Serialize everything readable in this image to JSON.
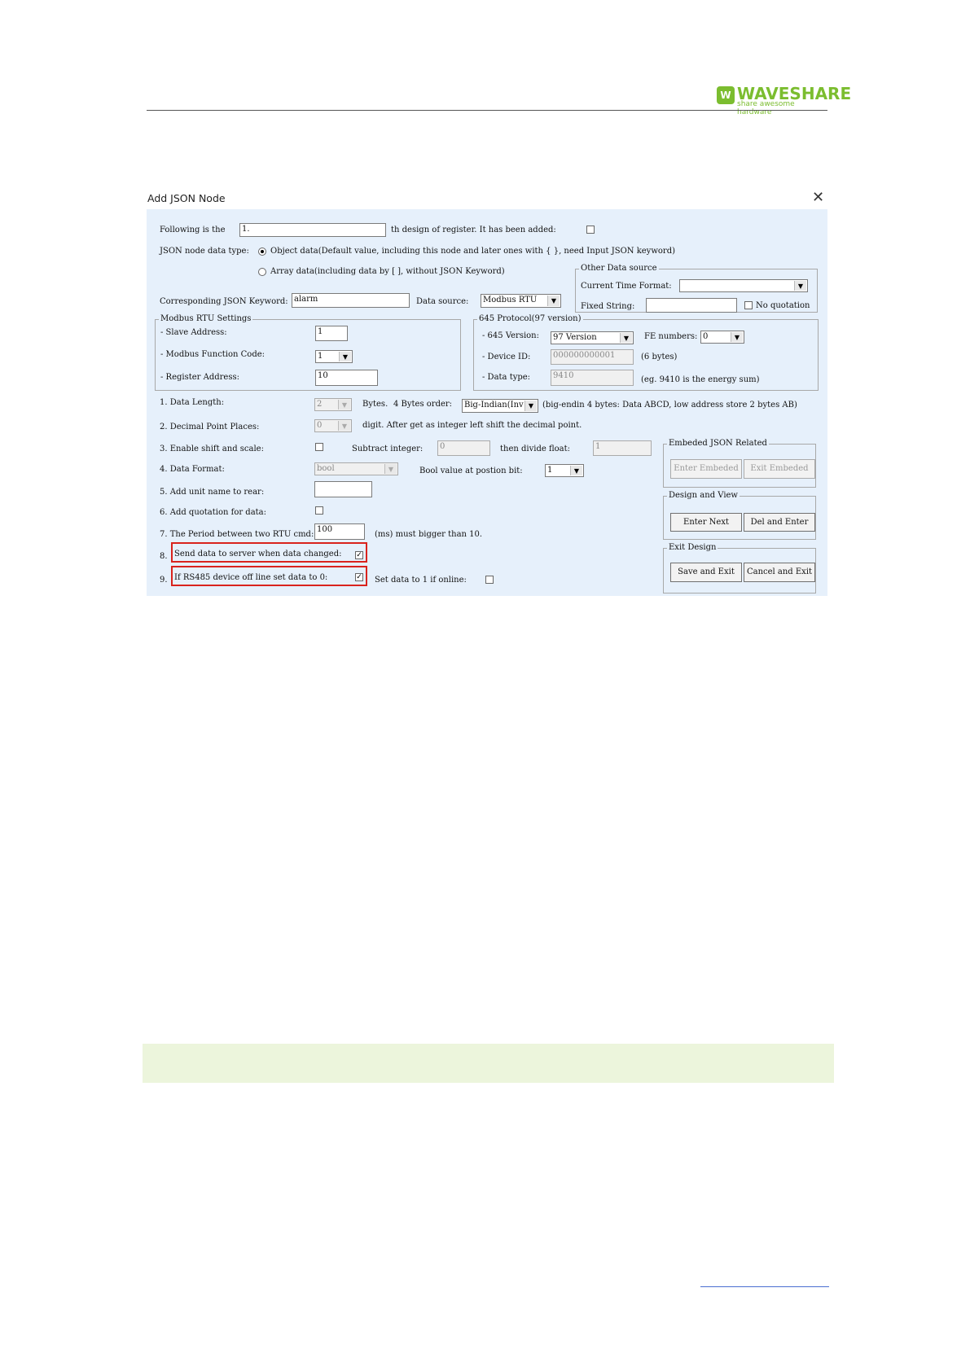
{
  "page_header": {
    "logo_badge": "W",
    "logo_name": "WAVESHARE",
    "logo_tagline": "share awesome hardware",
    "brand_color": "#7bbd2f"
  },
  "dialog": {
    "title": "Add JSON Node",
    "close_icon": "close-icon",
    "following_label": "Following is the",
    "register_index": "1.",
    "register_suffix": "th design of register. It has been added:",
    "node_type_label": "JSON node data type:",
    "object_option": "Object data(Default value, including this node and later ones with { }, need Input JSON keyword)",
    "array_option": "Array data(including data by [ ], without JSON Keyword)",
    "keyword_label": "Corresponding JSON Keyword:",
    "keyword_value": "alarm",
    "data_source_label": "Data source:",
    "data_source_value": "Modbus RTU",
    "other_source": {
      "title": "Other Data source",
      "time_format_label": "Current Time Format:",
      "time_format_value": "",
      "fixed_string_label": "Fixed String:",
      "fixed_string_value": "",
      "no_quotation_label": "No quotation"
    },
    "modbus": {
      "title": "Modbus RTU Settings",
      "slave_label": "- Slave Address:",
      "slave_value": "1",
      "function_label": "- Modbus Function Code:",
      "function_value": "1",
      "register_label": "- Register Address:",
      "register_value": "10"
    },
    "protocol645": {
      "title": "645 Protocol(97 version)",
      "version_label": "- 645 Version:",
      "version_value": "97 Version",
      "fe_label": "FE numbers:",
      "fe_value": "0",
      "device_label": "- Device ID:",
      "device_value": "000000000001",
      "device_hint": "(6 bytes)",
      "type_label": "- Data type:",
      "type_value": "9410",
      "type_hint": "(eg. 9410 is the energy sum)"
    },
    "data_length_label": "1. Data Length:",
    "data_length_value": "2",
    "bytes_label": "Bytes.",
    "byte_order_label": "4 Bytes order:",
    "byte_order_value": "Big-Indian(Inv",
    "byte_order_hint": "(big-endin 4 bytes: Data ABCD, low address store 2 bytes AB)",
    "decimal_label": "2. Decimal Point Places:",
    "decimal_value": "0",
    "decimal_hint": "digit. After get as integer left shift the decimal point.",
    "shift_label": "3. Enable shift and scale:",
    "subtract_label": "Subtract integer:",
    "subtract_value": "0",
    "divide_label": "then divide float:",
    "divide_value": "1",
    "format_label": "4. Data Format:",
    "format_value": "bool",
    "bool_pos_label": "Bool value at postion bit:",
    "bool_pos_value": "1",
    "unit_label": "5. Add unit name to rear:",
    "unit_value": "",
    "quote_label": "6. Add quotation for data:",
    "period_label": "7. The Period between two RTU cmd:",
    "period_value": "100",
    "period_hint": "(ms) must bigger than 10.",
    "send_label_num": "8.",
    "send_label": "Send data to server when data changed:",
    "offline_label_num": "9.",
    "offline_label": "If RS485 device off line set data to 0:",
    "online_label": "Set data to 1 if online:",
    "embed": {
      "title": "Embeded JSON Related",
      "enter_label": "Enter Embeded",
      "exit_label": "Exit Embeded"
    },
    "design": {
      "title": "Design and View",
      "next_label": "Enter Next",
      "del_label": "Del and Enter"
    },
    "exit_design": {
      "title": "Exit Design",
      "save_label": "Save and Exit",
      "cancel_label": "Cancel and Exit"
    },
    "highlight_color": "#d9231d"
  }
}
